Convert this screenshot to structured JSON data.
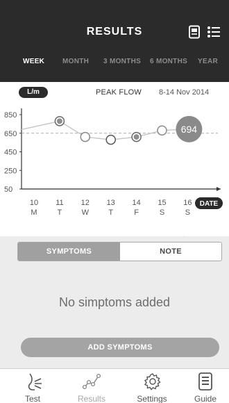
{
  "header": {
    "title": "RESULTS",
    "icons": [
      "document-icon",
      "list-icon"
    ]
  },
  "period_tabs": [
    {
      "label": "WEEK",
      "active": true
    },
    {
      "label": "MONTH",
      "active": false
    },
    {
      "label": "3 MONTHS",
      "active": false
    },
    {
      "label": "6 MONTHS",
      "active": false
    },
    {
      "label": "YEAR",
      "active": false
    }
  ],
  "chart": {
    "unit": "L/m",
    "title": "PEAK FLOW",
    "range": "8-14 Nov 2014",
    "date_button": "DATE"
  },
  "chart_data": {
    "type": "line",
    "y_ticks": [
      "850",
      "650",
      "450",
      "250",
      "50"
    ],
    "ylim": [
      50,
      850
    ],
    "reference_line": 650,
    "categories": [
      "10 M",
      "11 T",
      "12 W",
      "13 T",
      "14 F",
      "15 S",
      "16 S"
    ],
    "days": [
      {
        "num": "10",
        "dow": "M"
      },
      {
        "num": "11",
        "dow": "T"
      },
      {
        "num": "12",
        "dow": "W"
      },
      {
        "num": "13",
        "dow": "T"
      },
      {
        "num": "14",
        "dow": "F"
      },
      {
        "num": "15",
        "dow": "S"
      },
      {
        "num": "16",
        "dow": "S"
      }
    ],
    "series": [
      {
        "values": [
          null,
          780,
          610,
          580,
          610,
          680,
          694
        ]
      }
    ],
    "highlight_label": "694",
    "colors": {
      "filled_point": "#8f8f8f",
      "line": "#c8c8c8",
      "highlight": "#8a8a8a"
    }
  },
  "symptoms": {
    "tab_symptoms": "SYMPTOMS",
    "tab_note": "NOTE",
    "empty_message": "No simptoms added",
    "add_button": "ADD SYMPTOMS"
  },
  "nav": [
    {
      "label": "Test",
      "icon": "lungs-icon"
    },
    {
      "label": "Results",
      "icon": "chart-icon"
    },
    {
      "label": "Settings",
      "icon": "gear-icon"
    },
    {
      "label": "Guide",
      "icon": "guide-icon"
    }
  ]
}
